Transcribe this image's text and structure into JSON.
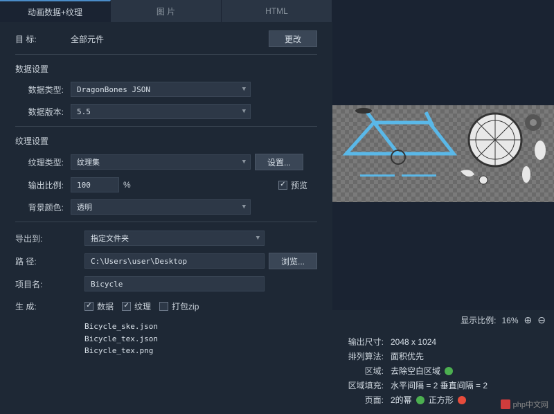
{
  "tabs": {
    "t0": "动画数据+纹理",
    "t1": "图 片",
    "t2": "HTML"
  },
  "target": {
    "label": "目 标:",
    "value": "全部元件",
    "change_btn": "更改"
  },
  "data_section": {
    "header": "数据设置",
    "type_label": "数据类型:",
    "type_value": "DragonBones JSON",
    "ver_label": "数据版本:",
    "ver_value": "5.5"
  },
  "tex_section": {
    "header": "纹理设置",
    "type_label": "纹理类型:",
    "type_value": "纹理集",
    "settings_btn": "设置...",
    "ratio_label": "输出比例:",
    "ratio_value": "100",
    "ratio_unit": "%",
    "preview_cb": "预览",
    "bg_label": "背景颜色:",
    "bg_value": "透明"
  },
  "export_section": {
    "to_label": "导出到:",
    "to_value": "指定文件夹",
    "path_label": "路 径:",
    "path_value": "C:\\Users\\user\\Desktop",
    "browse_btn": "浏览...",
    "proj_label": "项目名:",
    "proj_value": "Bicycle",
    "gen_label": "生 成:",
    "cb_data": "数据",
    "cb_tex": "纹理",
    "cb_zip": "打包zip",
    "files": [
      "Bicycle_ske.json",
      "Bicycle_tex.json",
      "Bicycle_tex.png"
    ]
  },
  "preview_bar": {
    "ratio_label": "显示比例:",
    "ratio_value": "16%"
  },
  "info": {
    "size_label": "输出尺寸:",
    "size_value": "2048 x 1024",
    "algo_label": "排列算法:",
    "algo_value": "面积优先",
    "region_label": "区域:",
    "region_value": "去除空白区域",
    "fill_label": "区域填充:",
    "fill_value": "水平间隔 = 2  垂直间隔 = 2",
    "page_label": "页面:",
    "page_v1": "2的幂",
    "page_v2": "正方形"
  },
  "watermark": "php中文网"
}
